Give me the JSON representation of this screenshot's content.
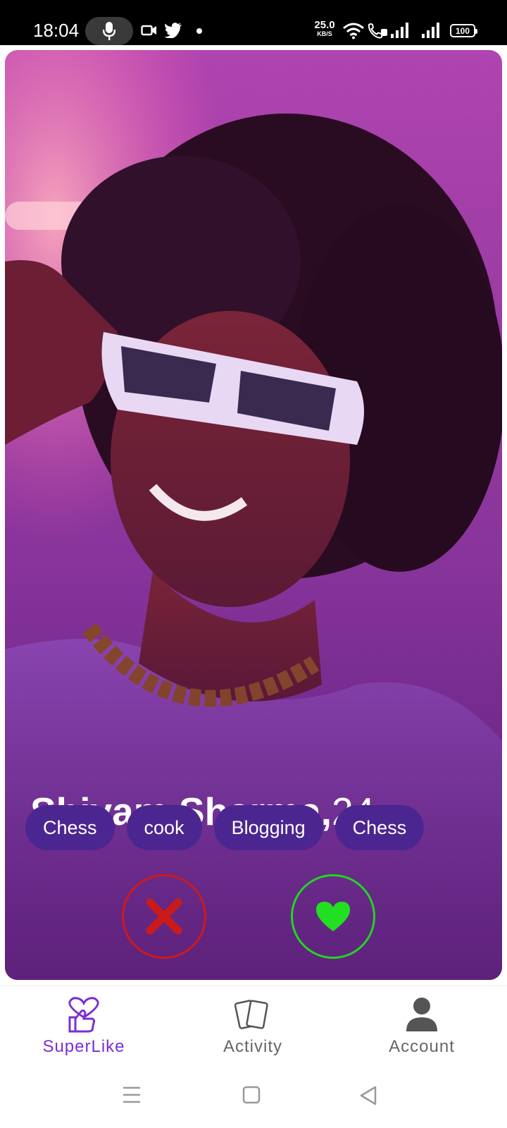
{
  "status_bar": {
    "time": "18:04",
    "net_speed_value": "25.0",
    "net_speed_unit": "KB/S",
    "battery": "100"
  },
  "profile": {
    "name": "Shivam Sharma,",
    "age": "24",
    "interests": [
      "Chess",
      "cook",
      "Blogging",
      "Chess"
    ]
  },
  "actions": {
    "reject_color": "#cc1a1a",
    "like_color": "#21d621"
  },
  "bottom_nav": {
    "items": [
      {
        "label": "SuperLike",
        "icon": "superlike-icon",
        "active": true
      },
      {
        "label": "Activity",
        "icon": "cards-icon",
        "active": false
      },
      {
        "label": "Account",
        "icon": "account-icon",
        "active": false
      }
    ],
    "active_color": "#7b2fd4",
    "inactive_color": "#666666"
  },
  "system_nav": {
    "buttons": [
      "menu-icon",
      "home-icon",
      "back-icon"
    ]
  }
}
